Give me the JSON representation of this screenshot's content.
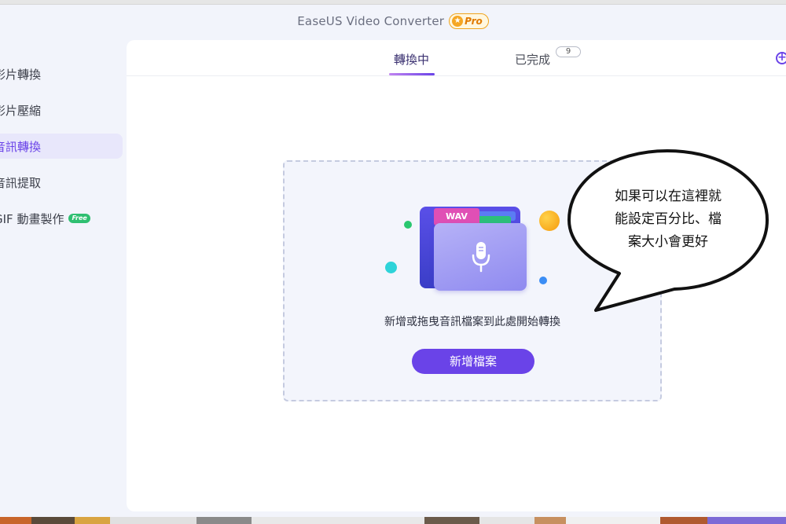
{
  "app": {
    "title": "EaseUS Video Converter",
    "pro_badge": "Pro"
  },
  "sidebar": {
    "items": [
      {
        "label": "影片轉換",
        "active": false
      },
      {
        "label": "影片壓縮",
        "active": false
      },
      {
        "label": "音訊轉換",
        "active": true
      },
      {
        "label": "音訊提取",
        "active": false
      },
      {
        "label": "GIF 動畫製作",
        "active": false,
        "badge": "Free"
      }
    ]
  },
  "tabs": {
    "converting": "轉換中",
    "completed": "已完成",
    "completed_count": "9"
  },
  "dropzone": {
    "file_type": "WAV",
    "hint": "新增或拖曳音訊檔案到此處開始轉換",
    "add_button": "新增檔案"
  },
  "annotation": {
    "line1": "如果可以在這裡就",
    "line2": "能設定百分比、檔",
    "line3": "案大小會更好"
  },
  "colors": {
    "accent": "#6a43e8",
    "active_bg": "#e8e7fb",
    "pro": "#f0a41d",
    "free": "#2fbf71"
  }
}
